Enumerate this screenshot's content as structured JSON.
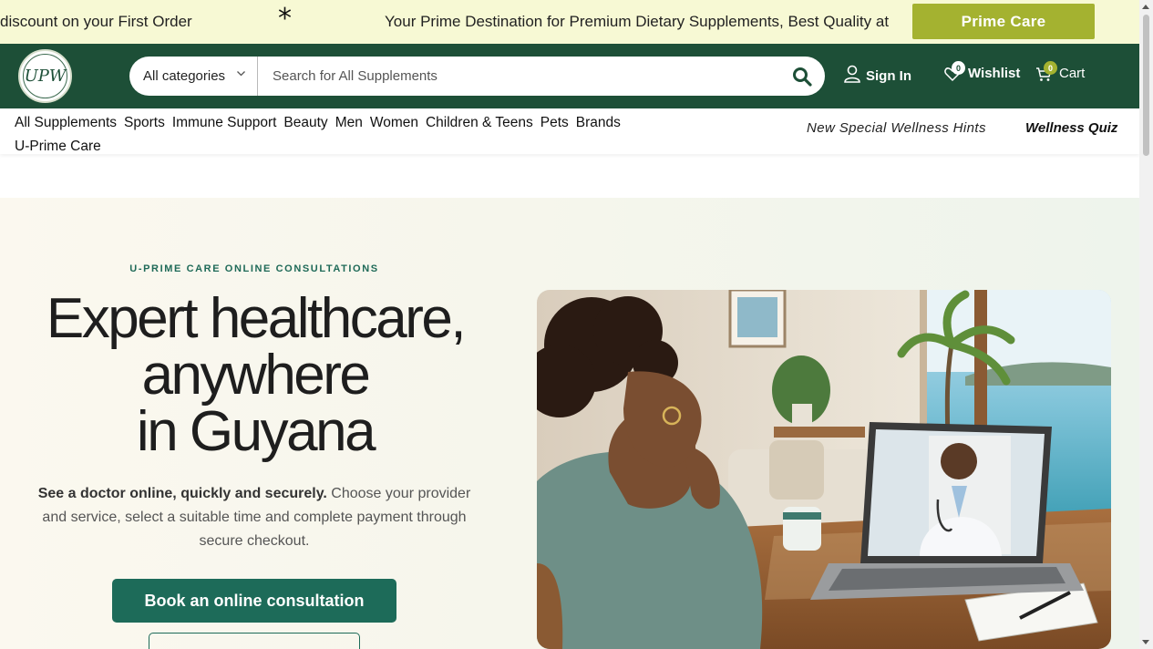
{
  "announcement": {
    "message_left": "discount on your First Order",
    "separator": "*",
    "message_right": "Your Prime Destination for Premium Dietary Supplements, Best Quality at",
    "cta_label": "Prime Care"
  },
  "header": {
    "logo_text": "UPW",
    "search": {
      "category_label": "All categories",
      "placeholder": "Search for All Supplements"
    },
    "sign_in_label": "Sign In",
    "wishlist_label": "Wishlist",
    "wishlist_count": "0",
    "cart_label": "Cart",
    "cart_count": "0"
  },
  "nav": {
    "items": [
      "All Supplements",
      "Sports",
      "Immune Support",
      "Beauty",
      "Men",
      "Women",
      "Children & Teens",
      "Pets",
      "Brands",
      "U-Prime Care"
    ],
    "hints_label": "New Special Wellness Hints",
    "quiz_label": "Wellness Quiz"
  },
  "hero": {
    "eyebrow": "U-PRIME CARE ONLINE CONSULTATIONS",
    "headline_line1": "Expert healthcare,",
    "headline_line2": "anywhere",
    "headline_line3": "in Guyana",
    "sub_bold": "See a doctor online, quickly and securely.",
    "sub_rest": " Choose your provider and service, select a suitable time and complete payment through secure checkout.",
    "primary_button": "Book an online consultation"
  },
  "colors": {
    "brand_green": "#1d4f37",
    "accent_olive": "#a4b230",
    "teal_button": "#1d6b59",
    "announce_bg": "#f7f9d4"
  },
  "icons": [
    "asterisk-icon",
    "chevron-down-icon",
    "search-icon",
    "user-icon",
    "heart-icon",
    "cart-icon"
  ]
}
